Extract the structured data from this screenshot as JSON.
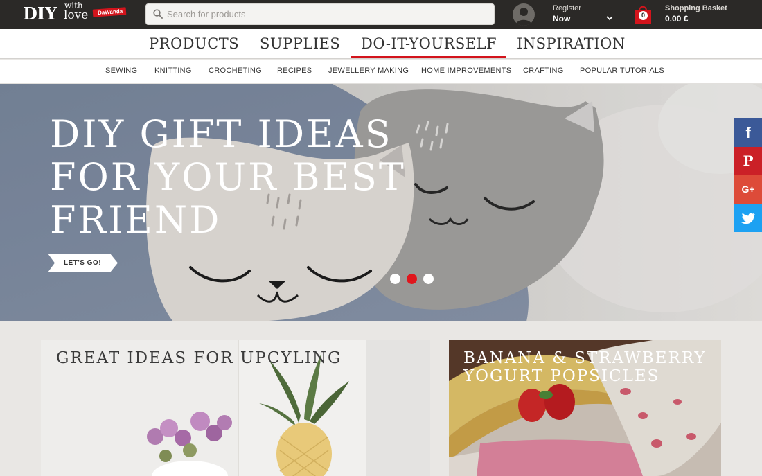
{
  "header": {
    "logo": {
      "main": "DIY",
      "with": "with",
      "love": "love",
      "tag": "DaWanda"
    },
    "search": {
      "placeholder": "Search for products"
    },
    "account": {
      "line1": "Register",
      "line2": "Now"
    },
    "cart": {
      "count": "0",
      "line1": "Shopping Basket",
      "line2": "0.00 €"
    }
  },
  "main_nav": {
    "items": [
      {
        "label": "PRODUCTS"
      },
      {
        "label": "SUPPLIES"
      },
      {
        "label": "DO-IT-YOURSELF",
        "active": true
      },
      {
        "label": "INSPIRATION"
      }
    ]
  },
  "sub_nav": {
    "items": [
      {
        "label": "SEWING"
      },
      {
        "label": "KNITTING"
      },
      {
        "label": "CROCHETING"
      },
      {
        "label": "RECIPES"
      },
      {
        "label": "JEWELLERY MAKING"
      },
      {
        "label": "HOME IMPROVEMENTS"
      },
      {
        "label": "CRAFTING"
      },
      {
        "label": "POPULAR TUTORIALS"
      }
    ]
  },
  "hero": {
    "title": "DIY GIFT IDEAS FOR YOUR BEST FRIEND",
    "cta": "LET'S GO!",
    "slides": 3,
    "active_slide": 2
  },
  "social": [
    {
      "name": "facebook",
      "glyph": "f",
      "color": "#3b5998"
    },
    {
      "name": "pinterest",
      "glyph": "P",
      "color": "#cb2027"
    },
    {
      "name": "google-plus",
      "glyph": "G+",
      "color": "#dd4b39"
    },
    {
      "name": "twitter",
      "glyph": "t",
      "color": "#1da1f2"
    }
  ],
  "cards": [
    {
      "title": "GREAT IDEAS FOR UPCYLING"
    },
    {
      "title": "BANANA & STRAWBERRY YOGURT POPSICLES"
    }
  ],
  "colors": {
    "accent": "#d3141c",
    "topbar": "#2b2927"
  }
}
